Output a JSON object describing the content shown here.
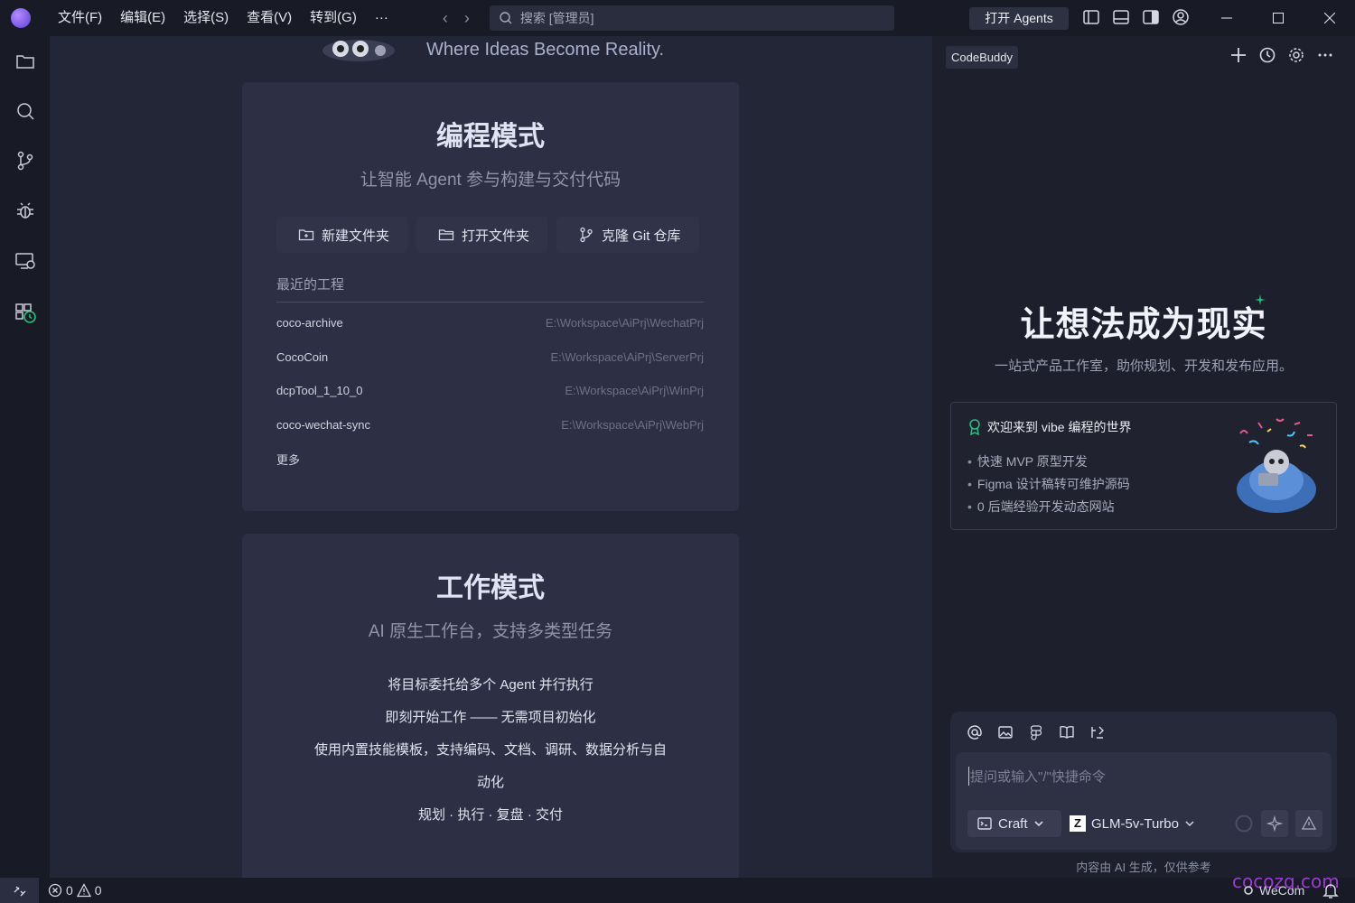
{
  "menu": {
    "items": [
      "文件(F)",
      "编辑(E)",
      "选择(S)",
      "查看(V)",
      "转到(G)",
      "···"
    ]
  },
  "search": {
    "placeholder": "搜索 [管理员]"
  },
  "titlebar": {
    "agents_label": "打开 Agents"
  },
  "editor": {
    "tagline": "Where Ideas Become Reality.",
    "coding_card": {
      "title": "编程模式",
      "subtitle": "让智能 Agent 参与构建与交付代码",
      "actions": {
        "new_folder": "新建文件夹",
        "open_folder": "打开文件夹",
        "clone_git": "克隆 Git 仓库"
      },
      "recent_title": "最近的工程",
      "recent": [
        {
          "name": "coco-archive",
          "path": "E:\\Workspace\\AiPrj\\WechatPrj"
        },
        {
          "name": "CocoCoin",
          "path": "E:\\Workspace\\AiPrj\\ServerPrj"
        },
        {
          "name": "dcpTool_1_10_0",
          "path": "E:\\Workspace\\AiPrj\\WinPrj"
        },
        {
          "name": "coco-wechat-sync",
          "path": "E:\\Workspace\\AiPrj\\WebPrj"
        }
      ],
      "more": "更多"
    },
    "work_card": {
      "title": "工作模式",
      "subtitle": "AI 原生工作台，支持多类型任务",
      "lines": [
        "将目标委托给多个 Agent 并行执行",
        "即刻开始工作 —— 无需项目初始化",
        "使用内置技能模板，支持编码、文档、调研、数据分析与自",
        "动化",
        "规划 · 执行 · 复盘 · 交付"
      ]
    }
  },
  "panel": {
    "tab": "CodeBuddy",
    "title": "让想法成为现实",
    "subtitle": "一站式产品工作室，助你规划、开发和发布应用。",
    "welcome": {
      "heading": "欢迎来到 vibe 编程的世界",
      "items": [
        "快速 MVP 原型开发",
        "Figma 设计稿转可维护源码",
        "0 后端经验开发动态网站"
      ]
    },
    "chat": {
      "placeholder": "提问或输入\"/\"快捷命令",
      "mode": "Craft",
      "model": "GLM-5v-Turbo"
    },
    "disclaimer": "内容由 AI 生成，仅供参考"
  },
  "statusbar": {
    "errors": "0",
    "warnings": "0",
    "wecom": "WeCom",
    "watermark": "cocozq.com"
  },
  "colors": {
    "accent": "#8b5cf6",
    "status_green": "#27c27d",
    "watermark": "#9b3bd0"
  }
}
